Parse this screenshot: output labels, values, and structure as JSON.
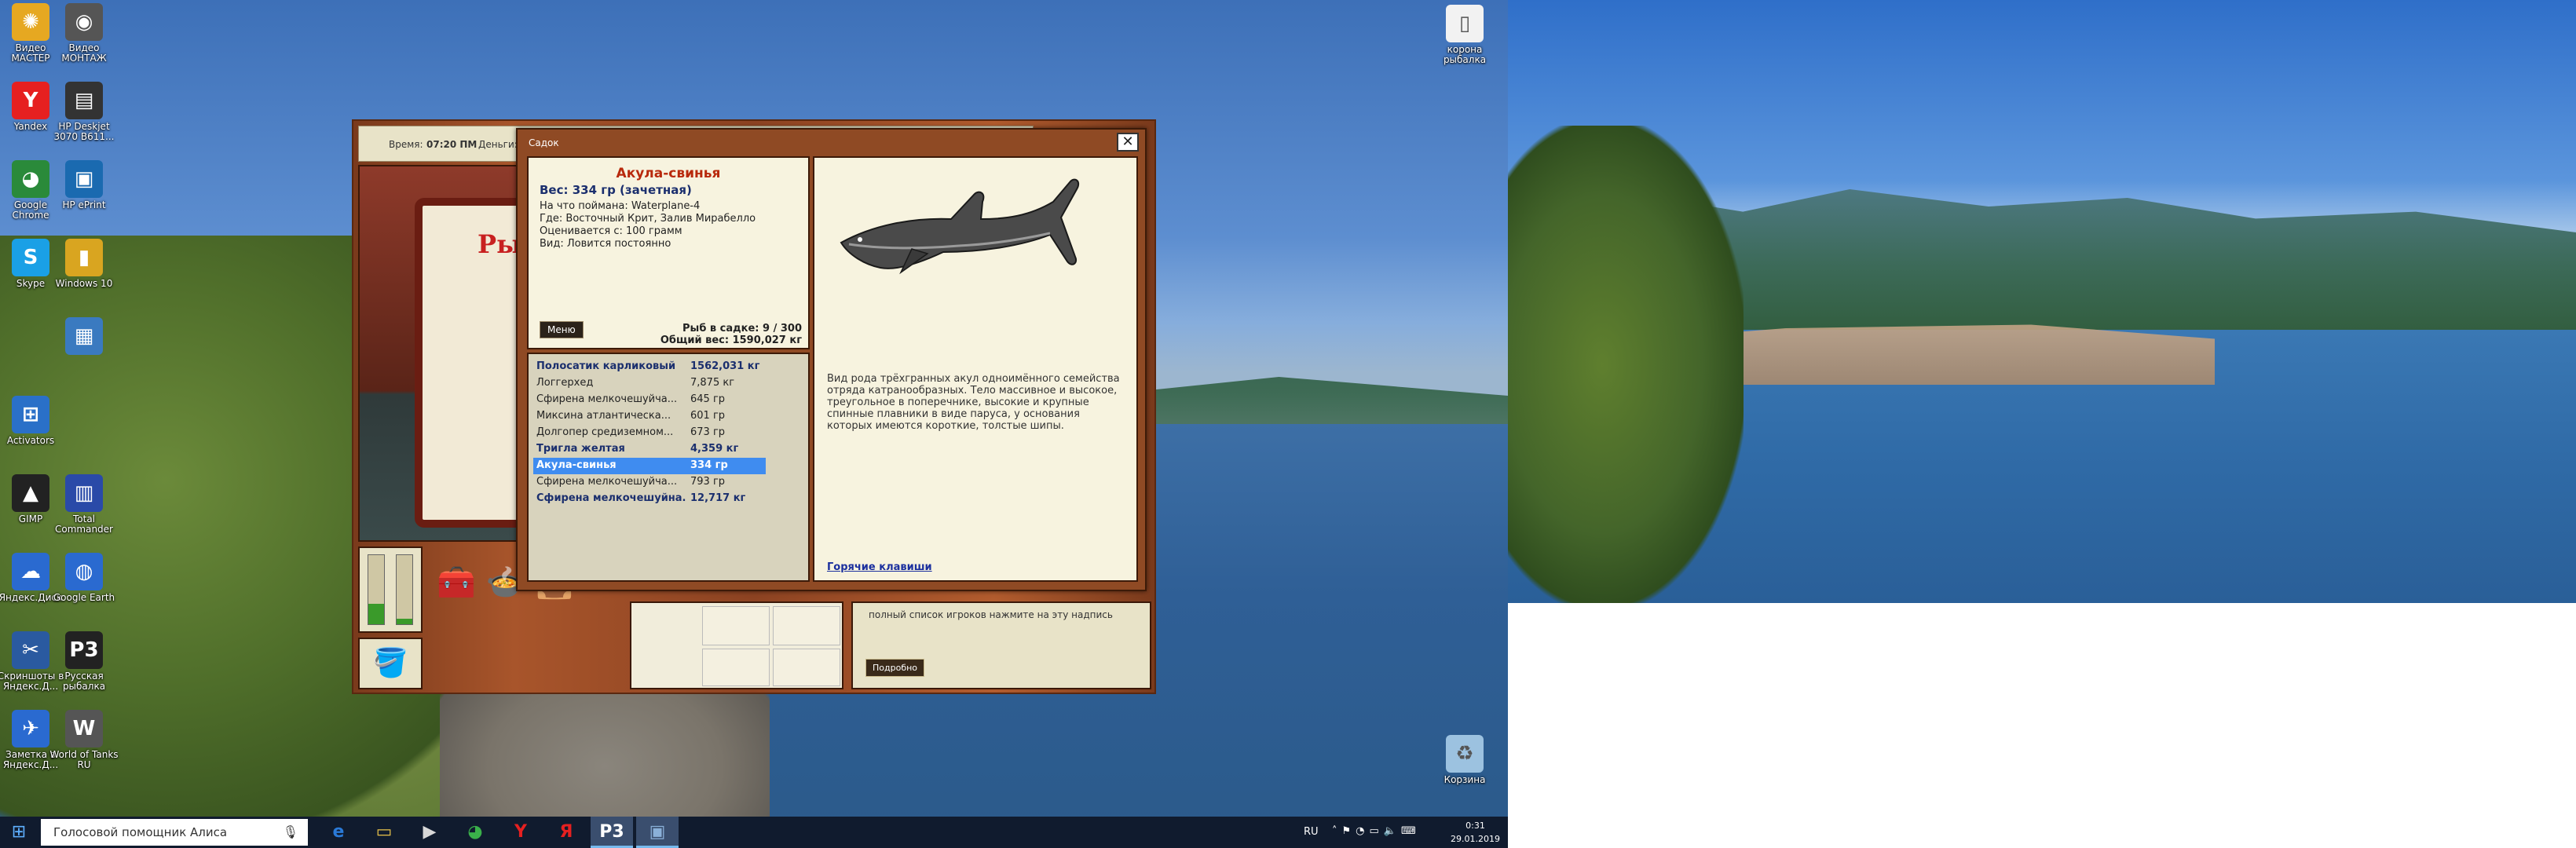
{
  "desktop": {
    "icons": [
      {
        "label": "Видео МАСТЕР",
        "color": "#e6a821",
        "glyph": "✺"
      },
      {
        "label": "Видео МОНТАЖ",
        "color": "#555555",
        "glyph": "◉"
      },
      {
        "label": "Yandex",
        "color": "#e62020",
        "glyph": "Y"
      },
      {
        "label": "HP Deskjet 3070 B611...",
        "color": "#333333",
        "glyph": "▤"
      },
      {
        "label": "Google Chrome",
        "color": "#2a8a3a",
        "glyph": "◕"
      },
      {
        "label": "HP ePrint",
        "color": "#1a6ab0",
        "glyph": "▣"
      },
      {
        "label": "Skype",
        "color": "#1aa0e6",
        "glyph": "S"
      },
      {
        "label": "Windows 10",
        "color": "#d9a520",
        "glyph": "▮"
      },
      {
        "label": "",
        "color": "#3a7ac0",
        "glyph": "▦"
      },
      {
        "label": "Activators",
        "color": "#2a70c8",
        "glyph": "⊞"
      },
      {
        "label": "GIMP",
        "color": "#222222",
        "glyph": "▲"
      },
      {
        "label": "Total Commander",
        "color": "#2a4aa8",
        "glyph": "▥"
      },
      {
        "label": "Яндекс.Диск",
        "color": "#2a6ad0",
        "glyph": "☁"
      },
      {
        "label": "Google Earth",
        "color": "#2a6ad0",
        "glyph": "◍"
      },
      {
        "label": "Скриншоты в Яндекс.Д...",
        "color": "#2a5aa0",
        "glyph": "✂"
      },
      {
        "label": "Русская рыбалка",
        "color": "#222222",
        "glyph": "P3"
      },
      {
        "label": "Заметка в Яндекс.Д...",
        "color": "#2a6ad0",
        "glyph": "✈"
      },
      {
        "label": "World of Tanks RU",
        "color": "#555555",
        "glyph": "W"
      }
    ],
    "right_icons": [
      {
        "label": "корона рыбалка",
        "color": "#f2f2f2",
        "glyph": "▯"
      },
      {
        "label": "Корзина",
        "color": "#9cc2e0",
        "glyph": "♻"
      }
    ]
  },
  "taskbar": {
    "start_icon": "windows-logo-icon",
    "search_placeholder": "Голосовой помощник Алиса",
    "apps": [
      {
        "name": "edge",
        "glyph": "e",
        "color": "#2a7ad8"
      },
      {
        "name": "explorer",
        "glyph": "▭",
        "color": "#e6c04a"
      },
      {
        "name": "media",
        "glyph": "▶",
        "color": "#d8d8d8"
      },
      {
        "name": "chrome",
        "glyph": "◕",
        "color": "#3ab04a"
      },
      {
        "name": "yandex-browser",
        "glyph": "Y",
        "color": "#e62020"
      },
      {
        "name": "yandex",
        "glyph": "Я",
        "color": "#e62020"
      },
      {
        "name": "rr3",
        "glyph": "P3",
        "color": "#ffffff"
      },
      {
        "name": "game-window",
        "glyph": "▣",
        "color": "#8ab0d8"
      }
    ],
    "lang": "RU",
    "time": "0:31",
    "date": "29.01.2019"
  },
  "game": {
    "time_label": "Время:",
    "time_value": "07:20 ПМ",
    "money_label": "Деньги:",
    "book_title": "Ры",
    "info_text": "полный список игроков нажмите на эту надпись",
    "details_button": "Подробно"
  },
  "dialog": {
    "title": "Садок",
    "fish_name": "Акула-свинья",
    "weight_line": "Вес: 334 гр (зачетная)",
    "caught_with": "На что поймана: Waterplane-4",
    "location": "Где: Восточный Крит, Залив Мирабелло",
    "rated_from": "Оценивается с: 100 грамм",
    "type": "Вид: Ловится постоянно",
    "menu_button": "Меню",
    "in_keepnet": "Рыб в садке: 9 / 300",
    "total_weight": "Общий вес: 1590,027 кг",
    "fish_list": [
      {
        "name": "Полосатик карликовый",
        "weight": "1562,031 кг",
        "bold": true,
        "selected": false
      },
      {
        "name": "Логгерхед",
        "weight": "7,875 кг",
        "bold": false,
        "selected": false
      },
      {
        "name": "Сфирена мелкочешуйча...",
        "weight": "645 гр",
        "bold": false,
        "selected": false
      },
      {
        "name": "Миксина атлантическа...",
        "weight": "601 гр",
        "bold": false,
        "selected": false
      },
      {
        "name": "Долгопер средиземном...",
        "weight": "673 гр",
        "bold": false,
        "selected": false
      },
      {
        "name": "Тригла желтая",
        "weight": "4,359 кг",
        "bold": true,
        "selected": false
      },
      {
        "name": "Акула-свинья",
        "weight": "334 гр",
        "bold": false,
        "selected": true
      },
      {
        "name": "Сфирена мелкочешуйча...",
        "weight": "793 гр",
        "bold": false,
        "selected": false
      },
      {
        "name": "Сфирена мелкочешуйна...",
        "weight": "12,717 кг",
        "bold": true,
        "selected": false
      }
    ],
    "description": "Вид рода трёхгранных акул одноимённого семейства отряда катранообразных. Тело массивное и высокое, треугольное в поперечнике, высокие и крупные спинные плавники в виде паруса, у основания которых имеются короткие, толстые шипы.",
    "hotkeys_link": "Горячие клавиши"
  }
}
